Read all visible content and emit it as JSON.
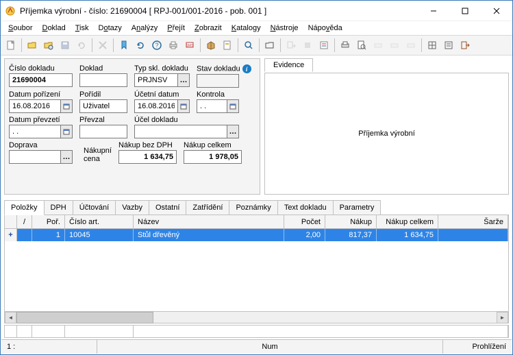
{
  "window": {
    "title": "Příjemka výrobní - číslo: 21690004  [ RPJ-001/001-2016 - pob. 001 ]"
  },
  "menu": {
    "soubor": "Soubor",
    "doklad": "Doklad",
    "tisk": "Tisk",
    "dotazy": "Dotazy",
    "analyzy": "Analýzy",
    "prejit": "Přejít",
    "zobrazit": "Zobrazit",
    "katalogy": "Katalogy",
    "nastroje": "Nástroje",
    "napoveda": "Nápověda"
  },
  "form": {
    "cislo_dokladu_label": "Číslo dokladu",
    "cislo_dokladu": "21690004",
    "doklad_label": "Doklad",
    "doklad": "",
    "typ_skl_label": "Typ skl. dokladu",
    "typ_skl": "PRJNSV",
    "stav_label": "Stav dokladu",
    "datum_porizeni_label": "Datum pořízení",
    "datum_porizeni": "16.08.2016",
    "poridil_label": "Pořídil",
    "poridil": "Uživatel",
    "ucetni_datum_label": "Účetní datum",
    "ucetni_datum": "16.08.2016",
    "kontrola_label": "Kontrola",
    "kontrola": ". .",
    "datum_prevzeti_label": "Datum převzetí",
    "datum_prevzeti": ". .",
    "prevzal_label": "Převzal",
    "prevzal": "",
    "ucel_label": "Účel dokladu",
    "ucel": "",
    "doprava_label": "Doprava",
    "doprava": "",
    "nakupni_cena_label": "Nákupní\ncena",
    "nakup_bez_label": "Nákup bez DPH",
    "nakup_bez": "1 634,75",
    "nakup_celkem_label": "Nákup celkem",
    "nakup_celkem": "1 978,05",
    "dots": "…"
  },
  "side": {
    "tab": "Evidence",
    "text": "Příjemka výrobní"
  },
  "tabs": {
    "polozky": "Položky",
    "dph": "DPH",
    "uctovani": "Účtování",
    "vazby": "Vazby",
    "ostatni": "Ostatní",
    "zatrideni": "Zatřídění",
    "poznamky": "Poznámky",
    "text_dokladu": "Text dokladu",
    "parametry": "Parametry"
  },
  "grid": {
    "h_slash": "/",
    "h_por": "Poř.",
    "h_cislo": "Číslo art.",
    "h_nazev": "Název",
    "h_pocet": "Počet",
    "h_nakup": "Nákup",
    "h_nakup_celkem": "Nákup celkem",
    "h_sarze": "Šarže",
    "row1": {
      "por": "1",
      "cislo": "10045",
      "nazev": "Stůl dřevěný",
      "pocet": "2,00",
      "nakup": "817,37",
      "nakup_celkem": "1 634,75",
      "sarze": ""
    }
  },
  "status": {
    "pos": "1 :",
    "num": "Num",
    "mode": "Prohlížení"
  }
}
